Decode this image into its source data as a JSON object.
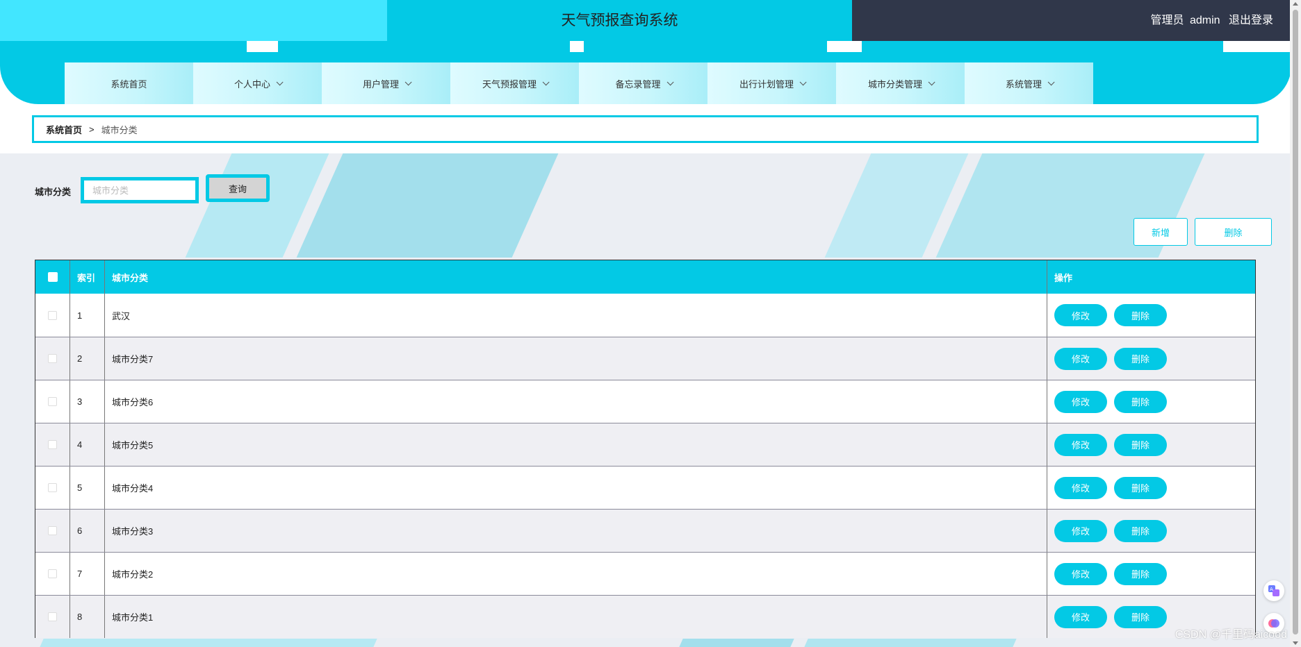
{
  "header": {
    "title": "天气预报查询系统",
    "user_role": "管理员",
    "username": "admin",
    "logout_label": "退出登录"
  },
  "nav": {
    "items": [
      {
        "label": "系统首页",
        "has_dropdown": false
      },
      {
        "label": "个人中心",
        "has_dropdown": true
      },
      {
        "label": "用户管理",
        "has_dropdown": true
      },
      {
        "label": "天气预报管理",
        "has_dropdown": true
      },
      {
        "label": "备忘录管理",
        "has_dropdown": true
      },
      {
        "label": "出行计划管理",
        "has_dropdown": true
      },
      {
        "label": "城市分类管理",
        "has_dropdown": true
      },
      {
        "label": "系统管理",
        "has_dropdown": true
      }
    ]
  },
  "breadcrumb": {
    "home": "系统首页",
    "separator": ">",
    "current": "城市分类"
  },
  "search": {
    "label": "城市分类",
    "placeholder": "城市分类",
    "value": "",
    "button_label": "查询"
  },
  "actions": {
    "add_label": "新增",
    "delete_label": "删除"
  },
  "table": {
    "columns": [
      "",
      "索引",
      "城市分类",
      "操作"
    ],
    "edit_label": "修改",
    "delete_label": "删除",
    "rows": [
      {
        "index": "1",
        "name": "武汉"
      },
      {
        "index": "2",
        "name": "城市分类7"
      },
      {
        "index": "3",
        "name": "城市分类6"
      },
      {
        "index": "4",
        "name": "城市分类5"
      },
      {
        "index": "5",
        "name": "城市分类4"
      },
      {
        "index": "6",
        "name": "城市分类3"
      },
      {
        "index": "7",
        "name": "城市分类2"
      },
      {
        "index": "8",
        "name": "城市分类1"
      }
    ]
  },
  "watermark": "CSDN @千里码aicood",
  "colors": {
    "accent": "#03c9e5",
    "accent_light": "#42e6ff",
    "header_dark": "#30374a",
    "page_bg": "#ebeef3"
  },
  "icons": [
    "chevron-down-icon",
    "translate-icon",
    "brain-icon",
    "scroll-up-icon",
    "scroll-down-icon"
  ]
}
